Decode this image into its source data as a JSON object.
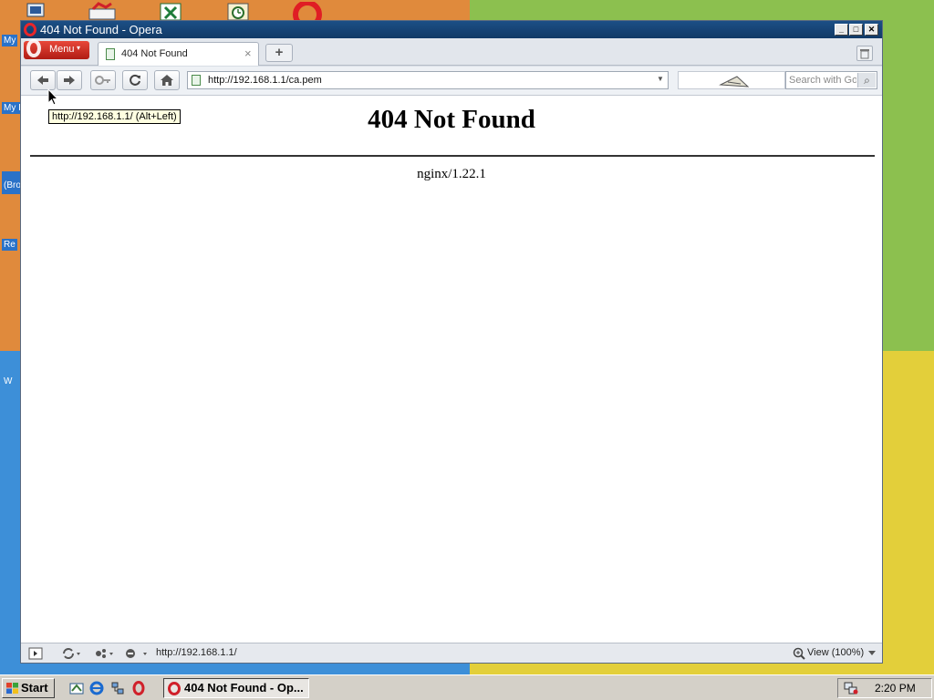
{
  "desktop": {
    "labels": [
      "My",
      "My I",
      "(Bro",
      "Re",
      "W"
    ]
  },
  "window": {
    "title": "404 Not Found - Opera",
    "caption_buttons": {
      "minimize": "_",
      "maximize": "□",
      "close": "✕"
    },
    "menu": {
      "label": "Menu",
      "caret": "▾"
    },
    "tab": {
      "title": "404 Not Found",
      "close": "×"
    },
    "new_tab": "+",
    "toolbar": {
      "back": "🡐",
      "forward": "🡒",
      "key": "⊸",
      "reload": "↻",
      "home": "⌂",
      "address": "http://192.168.1.1/ca.pem",
      "address_dropdown": "▼",
      "search_placeholder": "Search with Google",
      "search_icon": "⌕"
    },
    "tooltip": "http://192.168.1.1/ (Alt+Left)",
    "page": {
      "heading": "404 Not Found",
      "server": "nginx/1.22.1"
    },
    "statusbar": {
      "url": "http://192.168.1.1/",
      "zoom": "View (100%)"
    }
  },
  "taskbar": {
    "start": "Start",
    "task": "404 Not Found - Op...",
    "clock": "2:20 PM"
  },
  "colors": {
    "title_bar": "#1c4f86",
    "menu_button": "#c8241a",
    "wallpaper_orange": "#e08a3c",
    "wallpaper_green": "#8cc04f",
    "wallpaper_blue": "#3d8fd8",
    "wallpaper_yellow": "#e3cf3a"
  }
}
